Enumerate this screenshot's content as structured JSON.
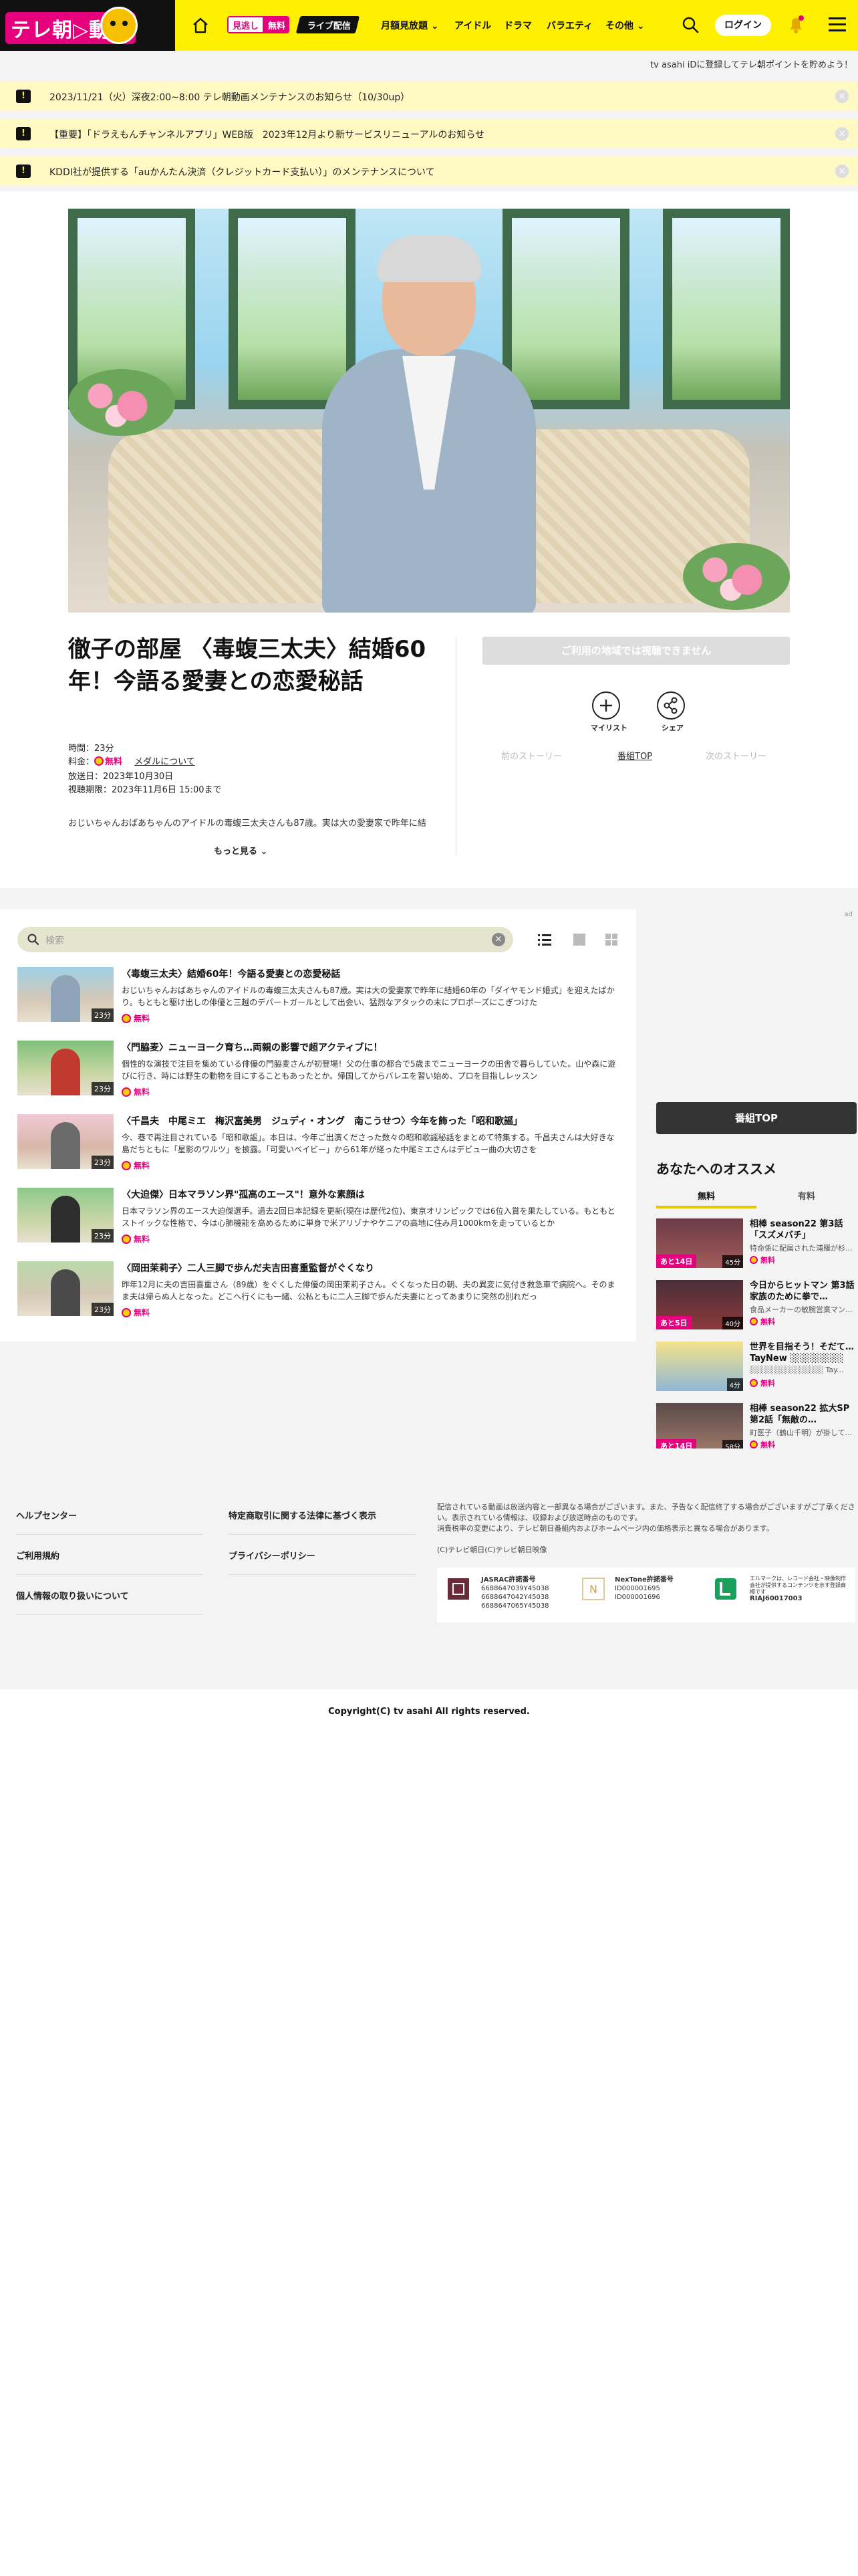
{
  "header": {
    "logo_text": "テレ朝▷動画",
    "badge_mitsu": "見逃し",
    "badge_free": "無料",
    "badge_live": "ライブ配信",
    "nav": [
      "月額見放題",
      "アイドル",
      "ドラマ",
      "バラエティ",
      "その他"
    ],
    "login": "ログイン"
  },
  "tagline": "tv asahi iDに登録してテレ朝ポイントを貯めよう！",
  "notices": [
    "2023/11/21（火）深夜2:00~8:00 テレ朝動画メンテナンスのお知らせ（10/30up）",
    "【重要】「ドラえもんチャンネルアプリ」WEB版　2023年12月より新サービスリニューアルのお知らせ",
    "KDDI社が提供する「auかんたん決済（クレジットカード支払い）」のメンテナンスについて"
  ],
  "episode": {
    "title": "徹子の部屋 〈毒蝮三太夫〉結婚60年！今語る愛妻との恋愛秘話",
    "time_label": "時間：23分",
    "price_label": "料金：",
    "price_value": "無料",
    "medal_link": "メダルについて",
    "aired": "放送日：2023年10月30日",
    "expires": "視聴期限：2023年11月6日 15:00まで",
    "description": "おじいちゃんおばあちゃんのアイドルの毒蝮三太夫さんも87歳。実は大の愛妻家で昨年に結",
    "more": "もっと見る"
  },
  "actions": {
    "unavailable": "ご利用の地域では視聴できません",
    "mylist": "マイリスト",
    "share": "シェア",
    "prev": "前のストーリー",
    "top": "番組TOP",
    "next": "次のストーリー"
  },
  "list": {
    "search_placeholder": "検索",
    "items": [
      {
        "title": "〈毒蝮三太夫〉結婚60年！今語る愛妻との恋愛秘話",
        "body": "おじいちゃんおばあちゃんのアイドルの毒蝮三太夫さんも87歳。実は大の愛妻家で昨年に結婚60年の「ダイヤモンド婚式」を迎えたばかり。もともと駆け出しの俳優と三越のデパートガールとして出会い、猛烈なアタックの末にプロポーズにこぎつけた",
        "duration": "23分",
        "free": "無料"
      },
      {
        "title": "〈門脇麦〉ニューヨーク育ち…両親の影響で超アクティブに！",
        "body": "個性的な演技で注目を集めている俳優の門脇麦さんが初登場！父の仕事の都合で5歳までニューヨークの田舎で暮らしていた。山や森に遊びに行き、時には野生の動物を目にすることもあったとか。帰国してからバレエを習い始め、プロを目指しレッスン",
        "duration": "23分",
        "free": "無料"
      },
      {
        "title": "〈千昌夫　中尾ミエ　梅沢富美男　ジュディ・オング　南こうせつ〉今年を飾った「昭和歌謡」",
        "body": "今、巷で再注目されている「昭和歌謡」。本日は、今年ご出演くださった数々の昭和歌謡秘話をまとめて特集する。千昌夫さんは大好きな島だちともに「星影のワルツ」を披露。「可愛いベイビー」から61年が経った中尾ミエさんはデビュー曲の大切さを",
        "duration": "23分",
        "free": "無料"
      },
      {
        "title": "〈大迫傑〉日本マラソン界\"孤高のエース\"！意外な素顔は",
        "body": "日本マラソン界のエース大迫傑選手。過去2回日本記録を更新(現在は歴代2位)、東京オリンピックでは6位入賞を果たしている。もともとストイックな性格で、今は心肺機能を高めるために単身で米アリゾナやケニアの高地に住み月1000kmを走っているとか",
        "duration": "23分",
        "free": "無料"
      },
      {
        "title": "〈岡田茉莉子〉二人三脚で歩んだ夫吉田喜重監督がぐくなり",
        "body": "昨年12月に夫の吉田喜重さん（89歳）をぐくした俳優の岡田茉莉子さん。ぐくなった日の朝、夫の異変に気付き救急車で病院へ。そのまま夫は帰らぬ人となった。どこへ行くにも一緒、公私ともに二人三脚で歩んだ夫妻にとってあまりに突然の別れだっ",
        "duration": "23分",
        "free": "無料"
      }
    ]
  },
  "sidebar": {
    "ad_mark": "ad",
    "program_top": "番組TOP",
    "heading": "あなたへのオススメ",
    "tab_free": "無料",
    "tab_paid": "有料",
    "items": [
      {
        "title": "相棒 season22 第3話「スズメバチ」",
        "desc": "特命係に配属された浦羅が杉...",
        "left": "あと14日",
        "duration": "45分",
        "free": "無料"
      },
      {
        "title": "今日からヒットマン 第3話 家族のために拳で…",
        "desc": "食品メーカーの敏腕営業マン...",
        "left": "あと5日",
        "duration": "40分",
        "free": "無料"
      },
      {
        "title": "世界を目指そう！そだて… TayNew ░░░░░░░░",
        "desc": "░░░░░░░░░░░░░ Tay...",
        "left": "",
        "duration": "4分",
        "free": "無料"
      },
      {
        "title": "相棒 season22 拡大SP　第2話「無敵の…",
        "desc": "町医子（鶴山千明）が掛して...",
        "left": "あと14日",
        "duration": "58分",
        "free": "無料"
      }
    ]
  },
  "footer": {
    "links_col1": [
      "ヘルプセンター",
      "ご利用規約",
      "個人情報の取り扱いについて"
    ],
    "links_col2": [
      "特定商取引に関する法律に基づく表示",
      "プライバシーポリシー"
    ],
    "note": "配信されている動画は放送内容と一部異なる場合がございます。また、予告なく配信終了する場合がございますがご了承ください。表示されている情報は、収録および放送時点のものです。",
    "note2": "消費税率の変更により、テレビ朝日番組内およびホームページ内の価格表示と異なる場合があります。",
    "sub": "(C)テレビ朝日(C)テレビ朝日映像",
    "jasrac_name": "JASRAC許諾番号",
    "jasrac_nums": [
      "6688647039Y45038",
      "6688647042Y45038",
      "6688647065Y45038"
    ],
    "nextone_name": "NexTone許諾番号",
    "nextone_nums": [
      "ID000001695",
      "ID000001696"
    ],
    "lmark_text": "エルマークは、レコード会社・映像制作会社が提供するコンテンツを示す登録商標です",
    "lmark_num": "RIAJ60017003",
    "copyright": "Copyright(C) tv asahi All rights reserved."
  }
}
